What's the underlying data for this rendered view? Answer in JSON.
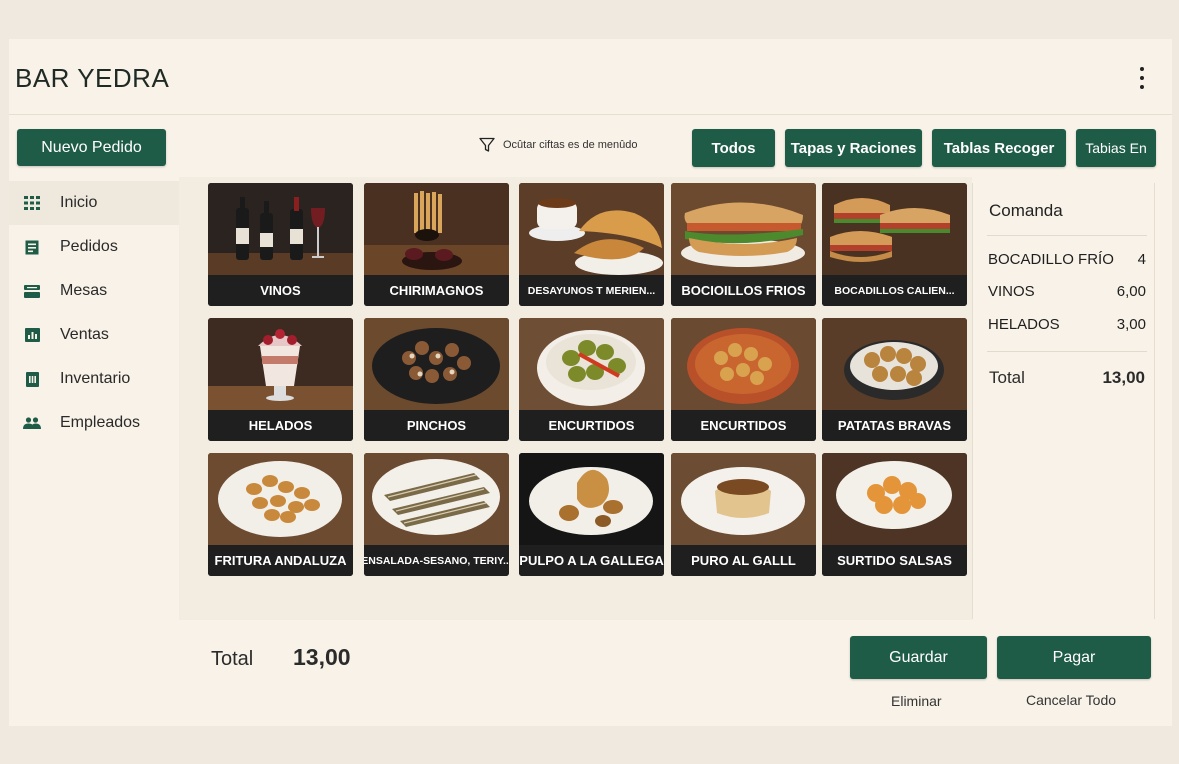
{
  "app": {
    "title": "BAR YEDRA"
  },
  "sidebar": {
    "new_order_label": "Nuevo Pedido",
    "items": [
      {
        "label": "Inicio",
        "icon": "grid-icon",
        "active": true
      },
      {
        "label": "Pedidos",
        "icon": "document-icon"
      },
      {
        "label": "Mesas",
        "icon": "table-icon"
      },
      {
        "label": "Ventas",
        "icon": "chart-icon"
      },
      {
        "label": "Inventario",
        "icon": "inventory-icon"
      },
      {
        "label": "Empleados",
        "icon": "people-icon"
      }
    ]
  },
  "toolbar": {
    "filter_label": "Ocûtar ciftas es de menûdo",
    "categories": [
      "Todos",
      "Tapas y Raciones",
      "Tablas Recoger",
      "Tabias En"
    ]
  },
  "products": [
    {
      "label": "VINOS"
    },
    {
      "label": "CHIRIMAGNOS"
    },
    {
      "label": "DESAYUNOS T MERIEN..."
    },
    {
      "label": "BOCIOILLOS FRIOS"
    },
    {
      "label": "BOCADILLOS CALIEN..."
    },
    {
      "label": "HELADOS"
    },
    {
      "label": "PINCHOS"
    },
    {
      "label": "ENCURTIDOS"
    },
    {
      "label": "ENCURTIDOS"
    },
    {
      "label": "PATATAS BRAVAS"
    },
    {
      "label": "FRITURA ANDALUZA"
    },
    {
      "label": "ENSALADA-SESANO, TERIY..."
    },
    {
      "label": "PULPO A LA GALLEGA"
    },
    {
      "label": "PURO AL GALLL"
    },
    {
      "label": "SURTIDO SALSAS"
    }
  ],
  "order": {
    "title": "Comanda",
    "items": [
      {
        "name": "BOCADILLO FRÍO",
        "value": "4"
      },
      {
        "name": "VINOS",
        "value": "6,00"
      },
      {
        "name": "HELADOS",
        "value": "3,00"
      }
    ],
    "total_label": "Total",
    "total_value": "13,00"
  },
  "footer": {
    "total_label": "Total",
    "total_value": "13,00",
    "save_label": "Guardar",
    "pay_label": "Pagar",
    "delete_label": "Eliminar",
    "cancel_label": "Cancelar Todo"
  },
  "colors": {
    "accent": "#1e5c48",
    "background": "#f8f2e8",
    "label_bar": "#1f1f1f"
  }
}
